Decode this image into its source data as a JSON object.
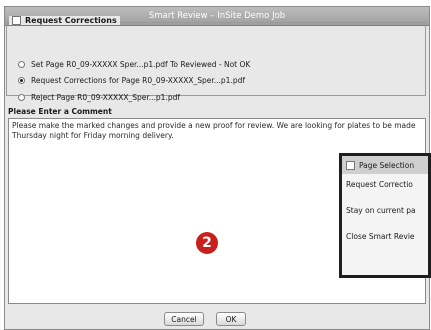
{
  "window": {
    "title": "Smart Review – InSite Demo Job"
  },
  "request_section": {
    "label": "Request Corrections",
    "options": [
      {
        "label": "Set Page R0_09-XXXXX Sper...p1.pdf To Reviewed - Not OK",
        "selected": false
      },
      {
        "label": "Request Corrections for Page R0_09-XXXXX_Sper...p1.pdf",
        "selected": true
      },
      {
        "label": "Reject Page R0_09-XXXXX_Sper...p1.pdf",
        "selected": false
      }
    ]
  },
  "comment": {
    "label": "Please Enter a Comment",
    "value": "Please make the marked changes and provide a new proof for review. We are looking for plates to be made Thursday night for Friday morning delivery."
  },
  "marker": {
    "number": "2",
    "color": "#c8211d"
  },
  "buttons": {
    "cancel": "Cancel",
    "ok": "OK"
  },
  "page_selection_popup": {
    "title": "Page Selection",
    "rows": [
      "Request Correctio",
      "Stay on current pa",
      "Close Smart Revie"
    ]
  }
}
